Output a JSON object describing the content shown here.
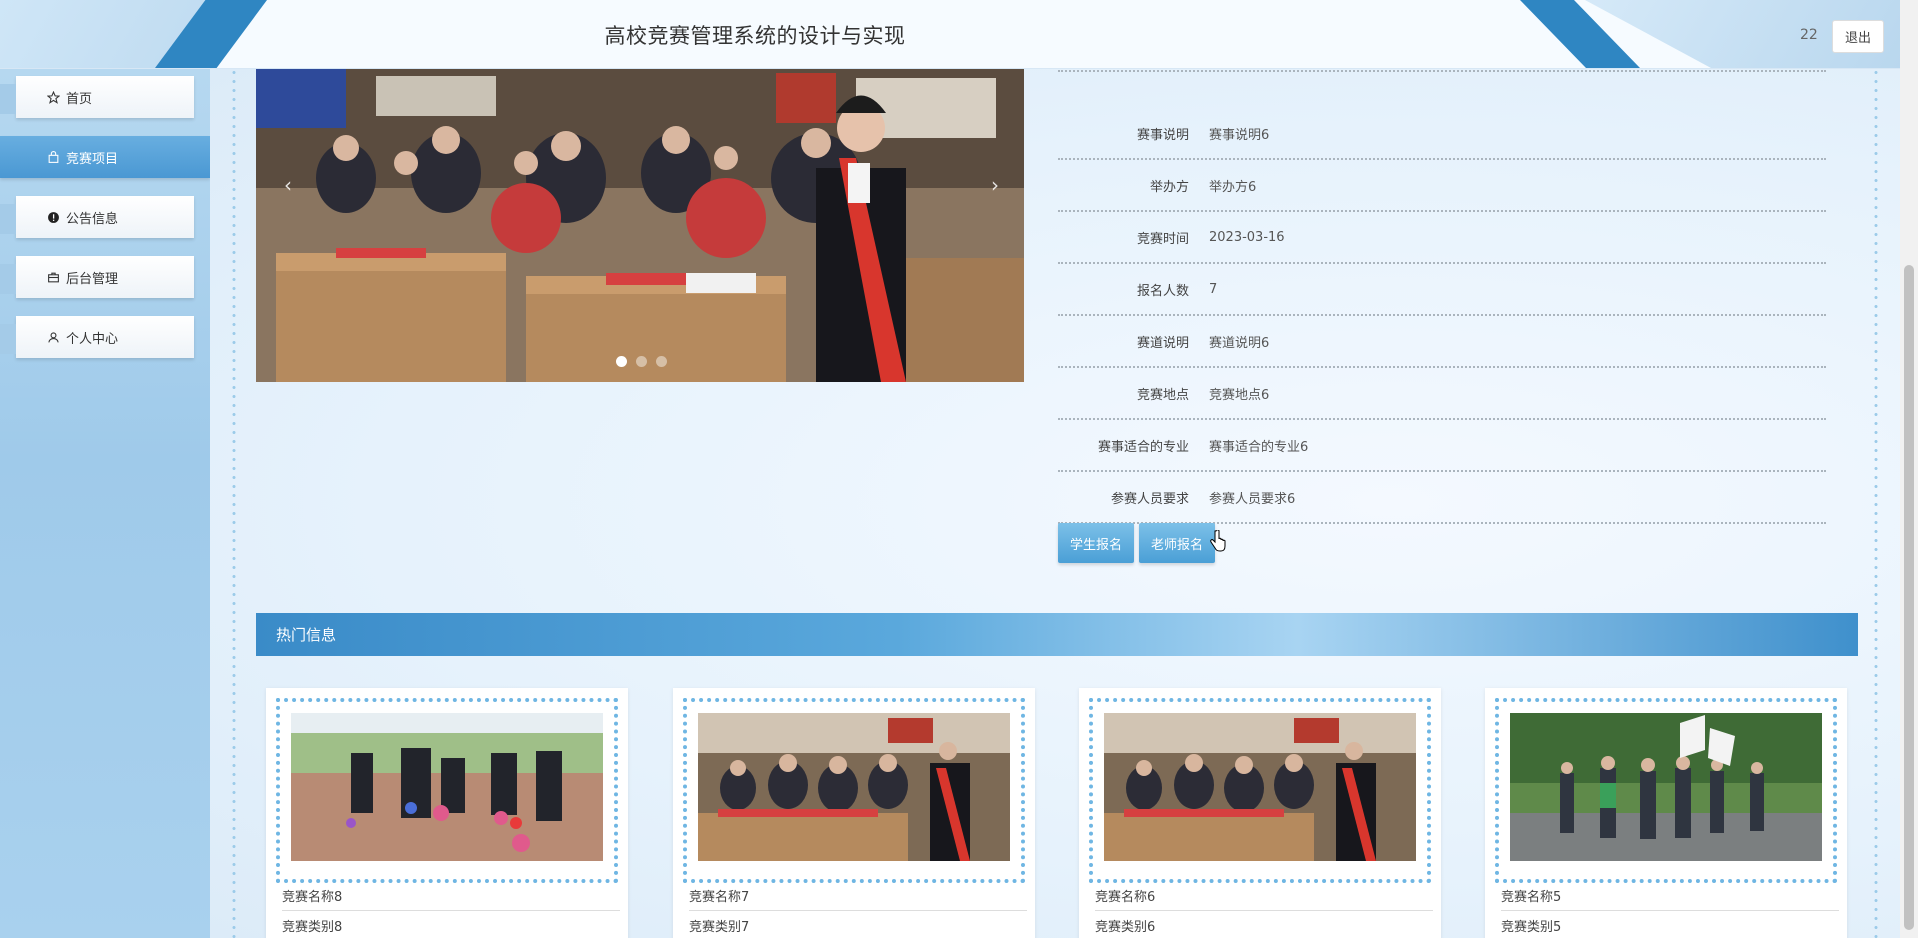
{
  "header": {
    "title": "高校竞赛管理系统的设计与实现",
    "user": "22",
    "logout_label": "退出"
  },
  "sidebar": {
    "items": [
      {
        "label": "首页",
        "icon": "star-outline-icon"
      },
      {
        "label": "竞赛项目",
        "icon": "bag-icon"
      },
      {
        "label": "公告信息",
        "icon": "info-circle-icon"
      },
      {
        "label": "后台管理",
        "icon": "briefcase-icon"
      },
      {
        "label": "个人中心",
        "icon": "user-icon"
      }
    ],
    "active_index": 1
  },
  "carousel": {
    "prev_label": "‹",
    "next_label": "›",
    "slide_count": 3,
    "active_slide": 1
  },
  "detail": {
    "rows": [
      {
        "label": "赛事说明",
        "value": "赛事说明6"
      },
      {
        "label": "举办方",
        "value": "举办方6"
      },
      {
        "label": "竞赛时间",
        "value": "2023-03-16"
      },
      {
        "label": "报名人数",
        "value": "7"
      },
      {
        "label": "赛道说明",
        "value": "赛道说明6"
      },
      {
        "label": "竞赛地点",
        "value": "竞赛地点6"
      },
      {
        "label": "赛事适合的专业",
        "value": "赛事适合的专业6"
      },
      {
        "label": "参赛人员要求",
        "value": "参赛人员要求6"
      }
    ]
  },
  "actions": {
    "student_signup": "学生报名",
    "teacher_signup": "老师报名"
  },
  "hot": {
    "title": "热门信息",
    "cards": [
      {
        "name": "竞赛名称8",
        "category": "竞赛类别8"
      },
      {
        "name": "竞赛名称7",
        "category": "竞赛类别7"
      },
      {
        "name": "竞赛名称6",
        "category": "竞赛类别6"
      },
      {
        "name": "竞赛名称5",
        "category": "竞赛类别5"
      }
    ]
  },
  "colors": {
    "accent": "#4a9fd6",
    "header_stripe": "#2f86c2",
    "card_border": "#6fb6e3"
  }
}
